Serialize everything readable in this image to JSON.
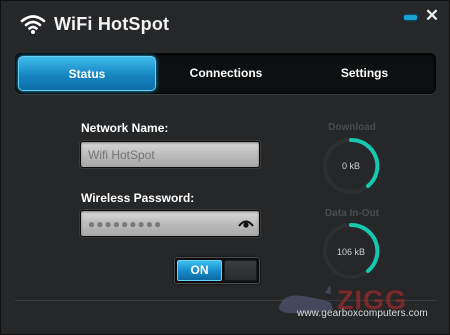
{
  "window": {
    "title": "WiFi HotSpot"
  },
  "titlebar": {
    "minimize_icon": "minimize-icon",
    "close_glyph": "✕"
  },
  "tabs": [
    {
      "label": "Status",
      "active": true
    },
    {
      "label": "Connections",
      "active": false
    },
    {
      "label": "Settings",
      "active": false
    }
  ],
  "form": {
    "network_name_label": "Network Name:",
    "network_name_value": "",
    "network_name_placeholder": "Wifi HotSpot",
    "password_label": "Wireless Password:",
    "password_value": "●●●●●●●●●",
    "password_icon": "eye-icon"
  },
  "toggle": {
    "label": "ON",
    "state": "on"
  },
  "gauges": {
    "download": {
      "title": "Download",
      "value": "0 kB"
    },
    "data_in_out": {
      "title": "Data In-Out",
      "value": "106 kB"
    }
  },
  "watermark": {
    "brand": "ZIGG",
    "url": "www.gearboxcomputers.com"
  },
  "colors": {
    "accent": "#1a9ad6",
    "background": "#262729",
    "gauge_ring": "#15c9b0"
  }
}
